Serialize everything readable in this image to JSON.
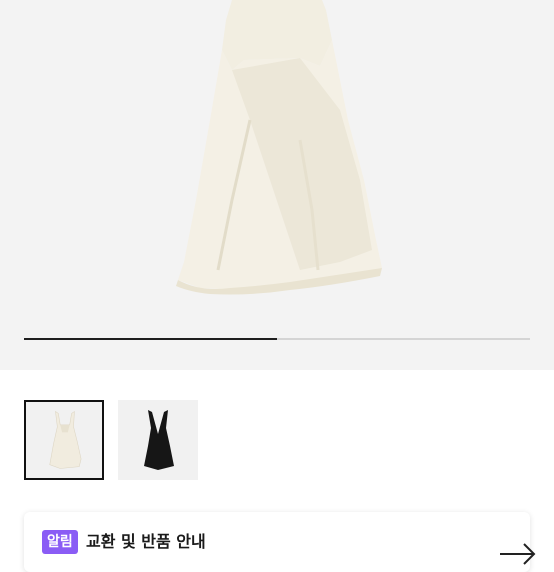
{
  "product_image": {
    "icon": "cream-dress-image",
    "dress_color": "#f3efe3",
    "background_color": "#f3f3f3"
  },
  "gallery": {
    "progress_fraction": 0.5,
    "thumbnails": [
      {
        "icon": "cream-dress-thumbnail",
        "selected": true
      },
      {
        "icon": "black-dress-thumbnail",
        "selected": false
      }
    ]
  },
  "notice": {
    "badge": "알림",
    "text": "교환 및 반품 안내",
    "badge_color": "#8a5cf5",
    "arrow_icon": "arrow-right-icon"
  }
}
